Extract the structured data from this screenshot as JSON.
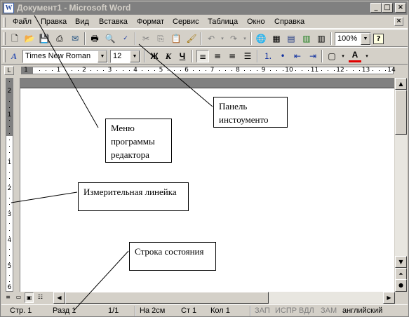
{
  "window": {
    "title": "Документ1 - Microsoft Word",
    "icon": "word-app-icon"
  },
  "window_buttons": {
    "minimize": "_",
    "maximize": "□",
    "close": "×"
  },
  "menu": {
    "items": [
      {
        "label": "Файл"
      },
      {
        "label": "Правка"
      },
      {
        "label": "Вид"
      },
      {
        "label": "Вставка"
      },
      {
        "label": "Формат"
      },
      {
        "label": "Сервис"
      },
      {
        "label": "Таблица"
      },
      {
        "label": "Окно"
      },
      {
        "label": "Справка"
      }
    ],
    "doc_close": "×"
  },
  "standard_toolbar": {
    "zoom": "100%",
    "help": "?"
  },
  "format_toolbar": {
    "font": "Times New Roman",
    "size": "12",
    "bold": "Ж",
    "italic": "К",
    "underline": "Ч",
    "font_color_letter": "A",
    "font_color": "#e00000"
  },
  "ruler": {
    "h_numbers": [
      "1",
      "1",
      "2",
      "3",
      "4",
      "5",
      "6",
      "7",
      "8",
      "9",
      "10",
      "11",
      "12",
      "13",
      "14"
    ],
    "v_numbers": [
      "2",
      "1",
      "1",
      "2",
      "3",
      "4",
      "5",
      "6"
    ],
    "tab_selector": "L"
  },
  "statusbar": {
    "page": "Стр. 1",
    "section": "Разд 1",
    "pages": "1/1",
    "at": "На 2см",
    "line": "Ст 1",
    "col": "Кол 1",
    "rec": "ЗАП",
    "trk": "ИСПР",
    "ext": "ВДЛ",
    "ovr": "ЗАМ",
    "lang": "английский"
  },
  "callouts": {
    "menu": "Меню программы редактора",
    "toolbar": "Панель инстоументо",
    "ruler": "Измерительная линейка",
    "status": "Строка состояния"
  },
  "colors": {
    "title_inactive": "#808080",
    "face": "#d4d0c8",
    "page": "#ffffff"
  }
}
